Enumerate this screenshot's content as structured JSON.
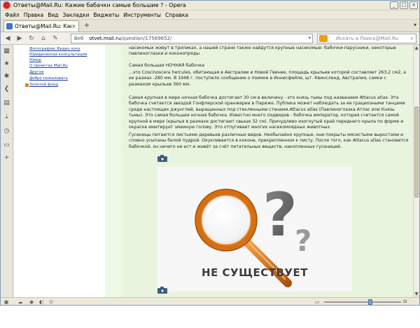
{
  "window": {
    "title": "Ответы@Mail.Ru: Кажие бабачкн самые большие ? - Opera",
    "buttons": [
      "minimize",
      "maximize",
      "close"
    ]
  },
  "menu": [
    "Файл",
    "Правка",
    "Вид",
    "Закладки",
    "Виджеты",
    "Инструменты",
    "Справка"
  ],
  "tabs": [
    {
      "label": "Ответы@Mail.Ru: Какн...",
      "active": true
    }
  ],
  "addressbar": {
    "site_label": "Веб",
    "url_host": "otvet.mail.ru",
    "url_path": "/question/17569652/",
    "search_placeholder": "Искать в Поиск@Mail.Ru"
  },
  "sidebar_links": [
    "Фотографии, Видео хочу",
    "Юридическая консультация",
    "Юмор",
    "О проектах Mail.Ru",
    "Другое",
    "Добро пожаловать",
    "Золотой фонд"
  ],
  "article": {
    "p0": "насекомых живут в тропиках, а нашей стране также найдутся крупные насекомые: бабочки-парусники, некоторые павлиноглазки и коконопряды",
    "p1_title": "Самая большая НОЧНАЯ бабочка",
    "p1": "...это Coscinoscera hercules, обитающая в Австралии и Новой Гвинее, площадь крыльев которой составляет 263,2 см2, а их размах -280 мм. В 1948 г. поступило сообщение о поимке в Иннисфейле, шт. Квинсленд, Австралия, самки с размахом крыльев 360 мм.",
    "p2": "Самая крупная в мире ночная бабочка достигает 30 см в величину - это князь тьмы под названием Attacus atlas. Эта бабочка считается звездой Гонфлерской оранжереи в Париже. Публика может наблюдать за ее грациозными танцами среди настоящих джунглей, выращенных под стеклянными стенами.Attacus atlas (Павлиноглазка Атлас или Князь тьмы). Это самая большая ночная бабочка. Известно много подвидов - бабочка император, которая считается самой крупной в мире (крылья в размахе достигают свыше 32 см). Причудливо изогнутый край переднего крыла по форме и окраске имитирует змеиную голову. Это отпугивает многих насекомоядных животных.",
    "p3": "Гусеницы питаются листьями деревьев различных видов. Необычайно крупные, они покрыты мясистыми выростами и словно усыпаны белой пудрой. Окукливается в коконе, прикрепленном к листу. После того, как Attacus atlas становится бабочкой, он ничего не ест и живёт за счёт питательных веществ, накопленных гусеницей.",
    "image_caption": "НЕ СУЩЕСТВУЕТ"
  },
  "colors": {
    "main_bg": "#e9f4df",
    "link": "#1a3f9a",
    "magnifier_ring": "#d46f12",
    "question_mark": "#5a5a5a",
    "caption": "#3c3c3c"
  },
  "statusbar": {
    "zoom_fraction": 0.6
  }
}
